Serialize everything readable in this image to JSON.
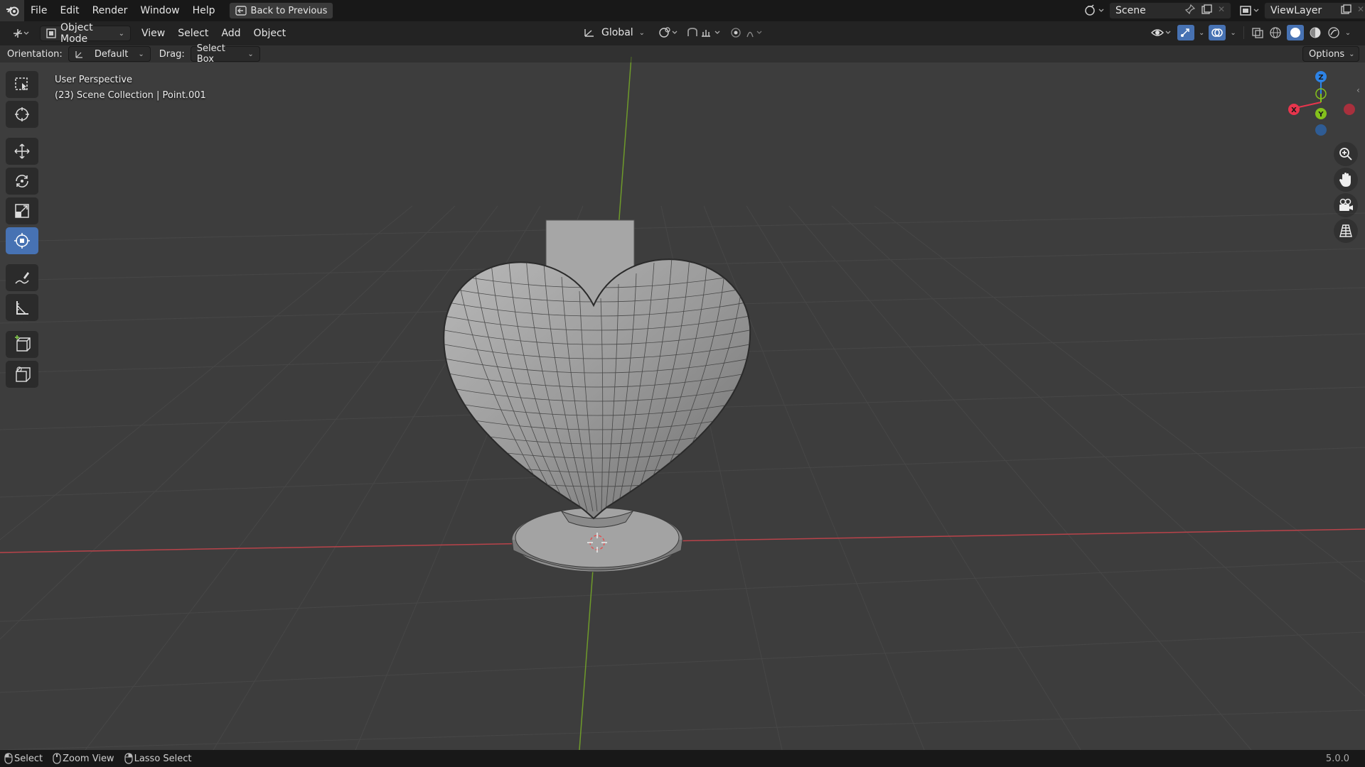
{
  "menubar": {
    "items": [
      "File",
      "Edit",
      "Render",
      "Window",
      "Help"
    ],
    "back_button": "Back to Previous",
    "scene_label": "Scene",
    "viewlayer_label": "ViewLayer"
  },
  "header": {
    "mode": "Object Mode",
    "menus": [
      "View",
      "Select",
      "Add",
      "Object"
    ],
    "transform_orientation": "Global"
  },
  "tool_header": {
    "orientation_label": "Orientation:",
    "orientation_value": "Default",
    "drag_label": "Drag:",
    "drag_value": "Select Box",
    "options_label": "Options"
  },
  "viewport": {
    "view_name": "User Perspective",
    "collection_info": "(23) Scene Collection | Point.001"
  },
  "gizmo": {
    "x_label": "X",
    "y_label": "Y",
    "z_label": "Z",
    "colors": {
      "x": "#e8354d",
      "y": "#84c11c",
      "z": "#2d83e6",
      "neg_x": "#a8303d",
      "neg_z": "#2f5c94"
    }
  },
  "status": {
    "items": [
      "Select",
      "Zoom View",
      "Lasso Select"
    ],
    "version": "5.0.0"
  },
  "toolbar_icons": [
    "select-box-icon",
    "cursor-icon",
    "move-icon",
    "rotate-icon",
    "scale-icon",
    "transform-icon",
    "annotate-icon",
    "measure-icon",
    "add-cube-icon",
    "add-object-icon"
  ],
  "colors": {
    "active": "#4772b3",
    "bg": "#3d3d3d"
  }
}
